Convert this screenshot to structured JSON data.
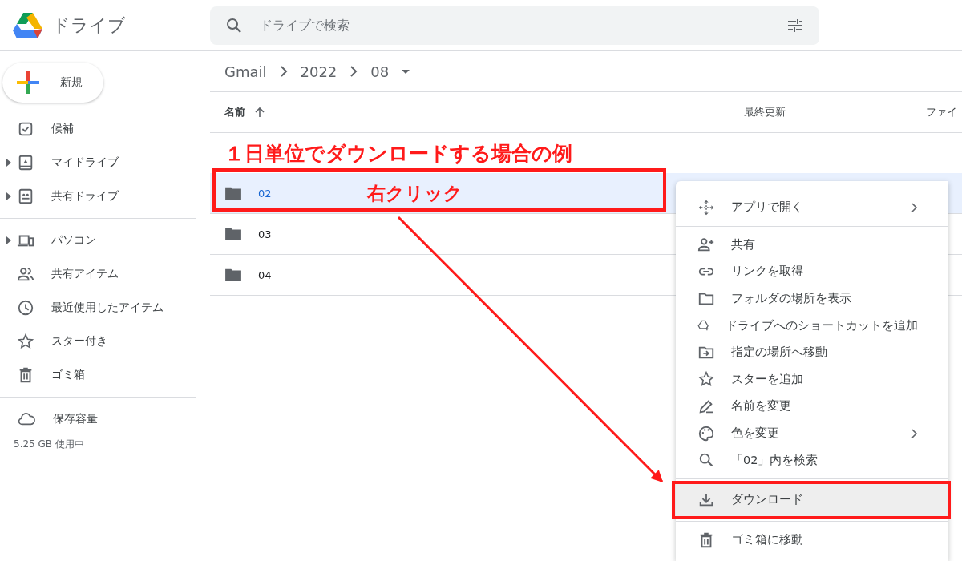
{
  "header": {
    "app_name": "ドライブ",
    "search": {
      "placeholder": "ドライブで検索"
    }
  },
  "sidebar": {
    "new_button": "新規",
    "sections": [
      {
        "items": [
          {
            "label": "候補",
            "expandable": false
          },
          {
            "label": "マイドライブ",
            "expandable": true
          },
          {
            "label": "共有ドライブ",
            "expandable": true
          }
        ]
      },
      {
        "items": [
          {
            "label": "パソコン",
            "expandable": true
          },
          {
            "label": "共有アイテム",
            "expandable": false
          },
          {
            "label": "最近使用したアイテム",
            "expandable": false
          },
          {
            "label": "スター付き",
            "expandable": false
          },
          {
            "label": "ゴミ箱",
            "expandable": false
          }
        ]
      }
    ],
    "storage": {
      "label": "保存容量",
      "usage": "5.25 GB 使用中"
    }
  },
  "breadcrumb": [
    "Gmail",
    "2022",
    "08"
  ],
  "table": {
    "columns": [
      {
        "label": "名前",
        "sorted": true
      },
      {
        "label": "最終更新",
        "sorted": false
      },
      {
        "label": "ファイ",
        "sorted": false
      }
    ],
    "rows": [
      {
        "name": "02",
        "selected": true,
        "framed": true
      },
      {
        "name": "03",
        "selected": false,
        "framed": false
      },
      {
        "name": "04",
        "selected": false,
        "framed": false
      }
    ]
  },
  "annotations": {
    "title": "１日単位でダウンロードする場合の例",
    "callout": "右クリック"
  },
  "context_menu": {
    "groups": [
      [
        {
          "label": "アプリで開く",
          "submenu": true,
          "highlighted": false,
          "framed": false
        }
      ],
      [
        {
          "label": "共有",
          "submenu": false,
          "highlighted": false,
          "framed": false
        },
        {
          "label": "リンクを取得",
          "submenu": false,
          "highlighted": false,
          "framed": false
        },
        {
          "label": "フォルダの場所を表示",
          "submenu": false,
          "highlighted": false,
          "framed": false
        },
        {
          "label": "ドライブへのショートカットを追加",
          "submenu": false,
          "highlighted": false,
          "framed": false
        },
        {
          "label": "指定の場所へ移動",
          "submenu": false,
          "highlighted": false,
          "framed": false
        },
        {
          "label": "スターを追加",
          "submenu": false,
          "highlighted": false,
          "framed": false
        },
        {
          "label": "名前を変更",
          "submenu": false,
          "highlighted": false,
          "framed": false
        },
        {
          "label": "色を変更",
          "submenu": true,
          "highlighted": false,
          "framed": false
        },
        {
          "label": "「02」内を検索",
          "submenu": false,
          "highlighted": false,
          "framed": false
        }
      ],
      [
        {
          "label": "ダウンロード",
          "submenu": false,
          "highlighted": true,
          "framed": true
        }
      ],
      [
        {
          "label": "ゴミ箱に移動",
          "submenu": false,
          "highlighted": false,
          "framed": false
        }
      ]
    ]
  }
}
